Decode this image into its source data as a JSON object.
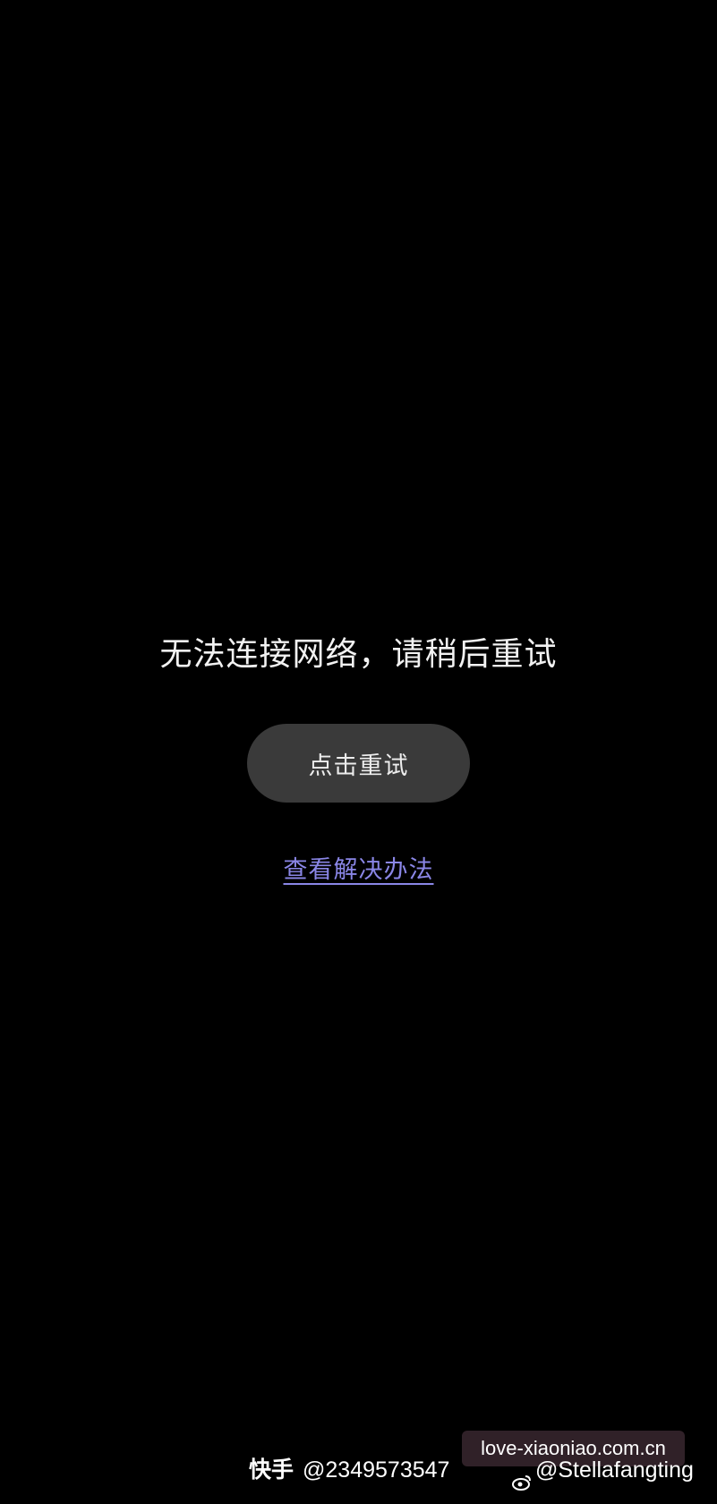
{
  "error": {
    "message": "无法连接网络，请稍后重试"
  },
  "actions": {
    "retry_label": "点击重试",
    "help_link_label": "查看解决办法"
  },
  "watermarks": {
    "url": "love-xiaoniao.com.cn",
    "kuaishou_brand": "快手",
    "kuaishou_id": "@2349573547",
    "weibo_handle": "@Stellafangting",
    "weibo_icon": "weibo-icon"
  },
  "colors": {
    "background": "#000000",
    "button_bg": "#3a3a3a",
    "link": "#8a86e6"
  }
}
